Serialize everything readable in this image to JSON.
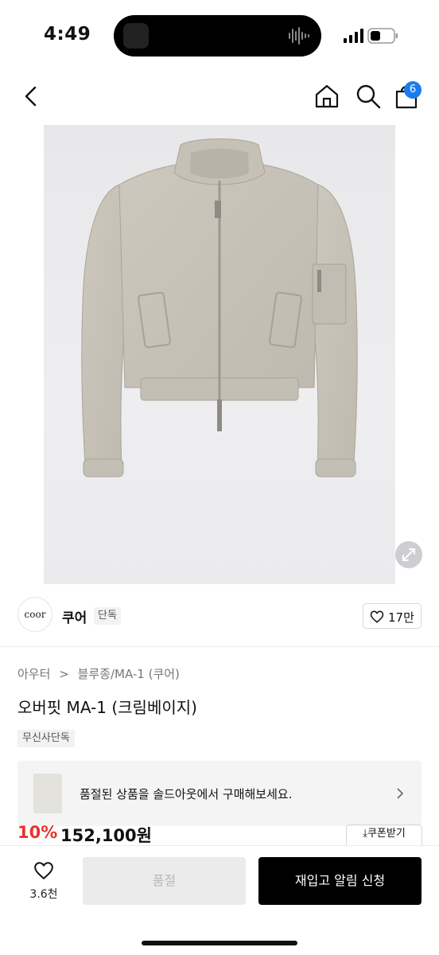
{
  "status_bar": {
    "time": "4:49"
  },
  "nav": {
    "cart_count": "6",
    "icons": [
      "back-chevron-icon",
      "home-icon",
      "search-icon",
      "cart-icon"
    ]
  },
  "brand": {
    "logo_text": "coor",
    "name": "쿠어",
    "tag": "단독",
    "likes": "17만"
  },
  "breadcrumb": [
    "아우터",
    ">",
    "블루종/MA-1 (쿠어)"
  ],
  "product": {
    "title": "오버핏 MA-1 (크림베이지)",
    "badge": "무신사단독",
    "discount": "10%",
    "price": "152,100원"
  },
  "soldout_banner": {
    "text": "품절된 상품을 솔드아웃에서 구매해보세요."
  },
  "coupon": {
    "label": "쿠폰받기"
  },
  "bottom_bar": {
    "wish_count": "3.6천",
    "soldout_label": "품절",
    "restock_label": "재입고 알림 신청"
  },
  "colors": {
    "accent_blue": "#1a7cf0",
    "discount_red": "#e8332b",
    "jacket_beige": "#c9c4b9"
  }
}
